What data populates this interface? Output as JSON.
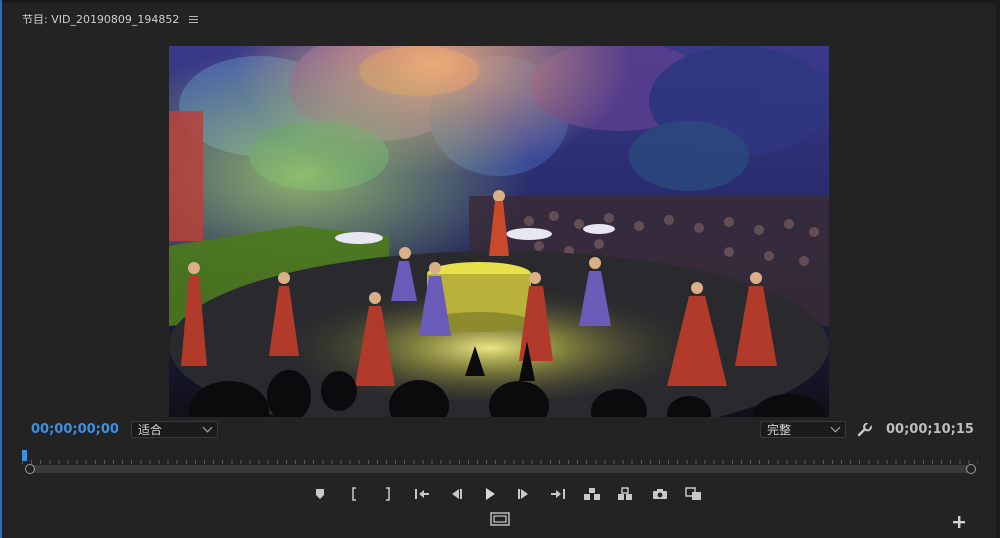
{
  "panel": {
    "title": "节目: VID_20190809_194852"
  },
  "timecode": {
    "current": "00;00;00;00",
    "duration": "00;00;10;15"
  },
  "zoom_select": {
    "value": "适合"
  },
  "quality_select": {
    "value": "完整"
  },
  "playhead_position_fraction": 0,
  "colors": {
    "accent_blue": "#3d8fe0",
    "panel_bg": "#232323"
  },
  "icons": {
    "panel_menu": "hamburger-icon",
    "settings": "wrench-icon",
    "transport": [
      "add-marker-icon",
      "mark-in-icon",
      "mark-out-icon",
      "go-to-in-icon",
      "step-back-icon",
      "play-icon",
      "step-forward-icon",
      "go-to-out-icon",
      "lift-icon",
      "extract-icon",
      "export-frame-icon",
      "comparison-view-icon"
    ],
    "extra": "safe-margins-icon",
    "add": "button-editor-plus-icon"
  }
}
